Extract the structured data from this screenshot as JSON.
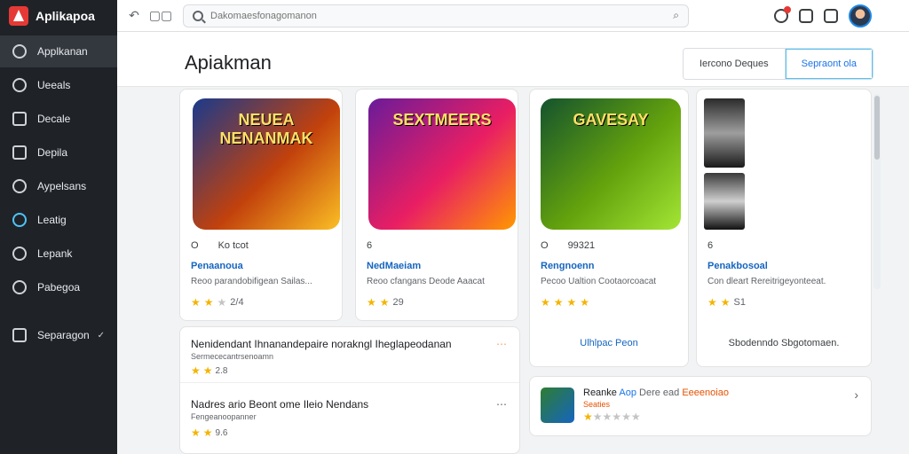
{
  "app": {
    "title": "Aplikapoa"
  },
  "sidebar": {
    "items": [
      {
        "label": "Applkanan",
        "icon": "apps-icon"
      },
      {
        "label": "Ueeals",
        "icon": "shield-icon"
      },
      {
        "label": "Decale",
        "icon": "tag-icon"
      },
      {
        "label": "Depila",
        "icon": "book-icon"
      },
      {
        "label": "Aypelsans",
        "icon": "check-circle-icon"
      },
      {
        "label": "Leatig",
        "icon": "circle-icon"
      },
      {
        "label": "Lepank",
        "icon": "clock-icon"
      },
      {
        "label": "Pabegoa",
        "icon": "pencil-icon"
      }
    ],
    "footer": {
      "label": "Separagon",
      "icon": "list-icon",
      "check": "✓"
    }
  },
  "topbar": {
    "search_placeholder": "Dakomaesfonagomanon",
    "back_icon": "↶",
    "grid_icon": "▢▢"
  },
  "header": {
    "title": "Apiakman",
    "seg": [
      {
        "label": "Iercono  Deques",
        "active": false
      },
      {
        "label": "Sepraont  ola",
        "active": true
      }
    ]
  },
  "cards": [
    {
      "image_title": "NEUEA NENANMAK",
      "meta_a": "O",
      "meta_b": "Ko  tcot",
      "name": "Penaanoua",
      "desc": "Reoo  parandobifigean  Sailas...",
      "rating": "2/4",
      "stars": [
        1,
        1,
        0
      ]
    },
    {
      "image_title": "SEXTMEERS",
      "meta_a": "6",
      "meta_b": "",
      "name": "NedMaeiam",
      "desc": "Reoo  cfangans  Deode  Aaacat",
      "rating": "29",
      "stars": [
        1,
        1
      ]
    },
    {
      "image_title": "GAVESAY",
      "meta_a": "O",
      "meta_b": "99321",
      "name": "Rengnoenn",
      "desc": "Pecoo  Ualtion  Cootaorcoacat",
      "rating": "",
      "stars": [
        1,
        1,
        1,
        1
      ],
      "bottom": "Ulhlpac  Peon"
    },
    {
      "image_title": "",
      "meta_a": "6",
      "meta_b": "",
      "name": "Penakbosoal",
      "desc": "Con  dleart  Rereitrigeyonteeat.",
      "rating": "S1",
      "stars": [
        1,
        1
      ],
      "bottom": "Sbodenndo  Sbgotomaen."
    }
  ],
  "list": [
    {
      "title": "Nenidendant  Ihnanandepaire  norakngl  Iheglapeodanan",
      "sub": "Sermececantrsenoamn",
      "rating": "2.8"
    },
    {
      "title": "Nadres  ario  Beont  ome  Ileio  Nendans",
      "sub": "Fengeanoopanner",
      "rating": "9.6"
    }
  ],
  "promo": {
    "title_a": "Reanke",
    "title_b": "Aop",
    "title_c": "Dere  ead",
    "title_d": "Eeeenoiao",
    "sub": "Seaties"
  },
  "colors": {
    "sidebar": "#1f2328",
    "accent": "#1a73e8",
    "star": "#f4b400",
    "brand": "#e53935"
  }
}
